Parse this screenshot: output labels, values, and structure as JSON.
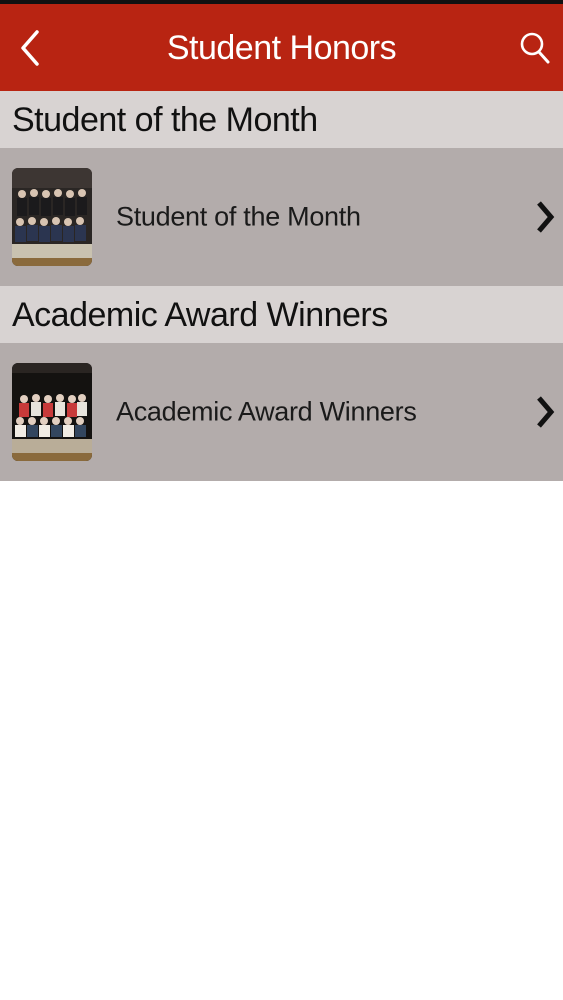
{
  "header": {
    "title": "Student Honors",
    "back_icon": "chevron-left-icon",
    "search_icon": "search-icon",
    "background_color": "#b82412"
  },
  "sections": [
    {
      "title": "Student of the Month",
      "items": [
        {
          "label": "Student of the Month",
          "thumbnail": "group-photo-thumbnail",
          "arrow_icon": "chevron-right-icon"
        }
      ]
    },
    {
      "title": "Academic Award Winners",
      "items": [
        {
          "label": "Academic Award Winners",
          "thumbnail": "group-photo-thumbnail",
          "arrow_icon": "chevron-right-icon"
        }
      ]
    }
  ]
}
